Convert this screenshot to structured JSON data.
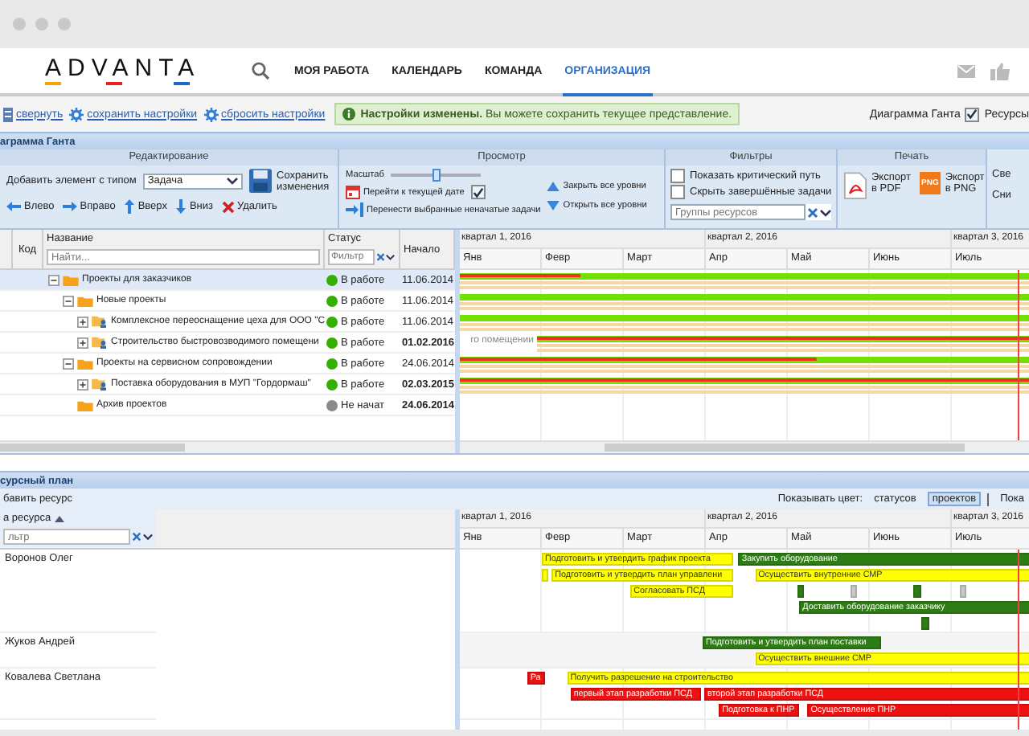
{
  "header": {
    "logo": "ADVANTA",
    "nav": [
      {
        "label": "МОЯ РАБОТА",
        "selected": false
      },
      {
        "label": "КАЛЕНДАРЬ",
        "selected": false
      },
      {
        "label": "КОМАНДА",
        "selected": false
      },
      {
        "label": "ОРГАНИЗАЦИЯ",
        "selected": true
      }
    ]
  },
  "toolbar": {
    "links": [
      {
        "label": "свернуть",
        "kind": "collapse"
      },
      {
        "label": "сохранить настройки",
        "kind": "settings"
      },
      {
        "label": "сбросить настройки",
        "kind": "settings"
      }
    ],
    "notice": "**Настройки изменены.** Вы можете сохранить текущее представление.",
    "view_toggles": [
      {
        "label": "Диаграмма Ганта",
        "checked": true
      },
      {
        "label": "Ресурсы"
      }
    ]
  },
  "gantt_panel": {
    "title": "аграмма Ганта",
    "ribbon": {
      "editing": {
        "title": "Редактирование",
        "add_label": "Добавить элемент с типом",
        "type_select": "Задача",
        "save_button": "Сохранить изменения",
        "move_buttons": [
          {
            "label": "Влево",
            "kind": "left"
          },
          {
            "label": "Вправо",
            "kind": "right"
          },
          {
            "label": "Вверх",
            "kind": "up"
          },
          {
            "label": "Вниз",
            "kind": "down"
          },
          {
            "label": "Удалить",
            "kind": "delete"
          }
        ]
      },
      "view": {
        "title": "Просмотр",
        "scale_label": "Масштаб",
        "scale": {
          "level": 0.5
        },
        "today_button": "Перейти к текущей дате",
        "today_checked": true,
        "transfer_button": "Перенести выбранные неначатые задачи",
        "level_buttons": [
          {
            "label": "Закрыть все уровни",
            "kind": "collapse"
          },
          {
            "label": "Открыть все уровни",
            "kind": "expand"
          }
        ]
      },
      "filters": {
        "title": "Фильтры",
        "checks": [
          {
            "label": "Показать критический путь",
            "checked": false
          },
          {
            "label": "Скрыть завершённые задачи",
            "checked": false
          }
        ],
        "resource_groups": {
          "placeholder": "Группы ресурсов"
        }
      },
      "print": {
        "title": "Печать",
        "buttons": [
          {
            "label": "Экспорт в PDF",
            "kind": "pdf"
          },
          {
            "label": "Экспорт в PNG",
            "kind": "png",
            "badge": "PNG"
          }
        ]
      },
      "cut_group": {
        "items": [
          "Све",
          "Сни"
        ]
      }
    },
    "grid": {
      "columns": [
        "Код",
        "Название",
        "Статус",
        "Начало"
      ],
      "name_filter": {
        "placeholder": "Найти..."
      },
      "status_filter": {
        "placeholder": "Фильтр"
      },
      "tasks": [
        {
          "name": "Проекты для заказчиков",
          "kind": "folder",
          "expanded": true,
          "selected": true,
          "status": "В работе",
          "color": "#33b000",
          "start": "11.06.2014",
          "start_bold": false,
          "children": [
            {
              "name": "Новые проекты",
              "kind": "folder",
              "expanded": true,
              "selected": false,
              "status": "В работе",
              "color": "#33b000",
              "start": "11.06.2014",
              "start_bold": false,
              "children": [
                {
                  "name": "Комплексное переоснащение цеха для ООО \"С",
                  "kind": "project",
                  "expanded": false,
                  "selected": false,
                  "status": "В работе",
                  "color": "#33b000",
                  "start": "11.06.2014",
                  "start_bold": false
                },
                {
                  "name": "Строительство быстровозводимого помещени",
                  "kind": "project",
                  "expanded": false,
                  "selected": false,
                  "status": "В работе",
                  "color": "#33b000",
                  "start": "01.02.2016",
                  "start_bold": true,
                  "chart_label": "го помещении"
                }
              ]
            },
            {
              "name": "Проекты на сервисном сопровождении",
              "kind": "folder",
              "expanded": true,
              "selected": false,
              "status": "В работе",
              "color": "#33b000",
              "start": "24.06.2014",
              "start_bold": false,
              "children": [
                {
                  "name": "Поставка оборудования в МУП \"Гордормаш\"",
                  "kind": "project",
                  "expanded": false,
                  "selected": false,
                  "status": "В работе",
                  "color": "#33b000",
                  "start": "02.03.2015",
                  "start_bold": true
                }
              ]
            },
            {
              "name": "Архив проектов",
              "kind": "folder",
              "selected": false,
              "status": "Не начат",
              "color": "#8a8a8a",
              "start": "24.06.2014",
              "start_bold": true
            }
          ]
        }
      ]
    },
    "chart": {
      "quarters": [
        "квартал 1, 2016",
        "квартал 2, 2016",
        "квартал 3, 2016"
      ],
      "months": [
        "Янв",
        "Февр",
        "Март",
        "Апр",
        "Май",
        "Июнь",
        "Июль"
      ]
    }
  },
  "resource_panel": {
    "title": "сурсный план",
    "add_button": "бавить ресурс",
    "color_label": "Показывать цвет:",
    "color_options": [
      {
        "label": "статусов",
        "selected": false
      },
      {
        "label": "проектов",
        "selected": true
      }
    ],
    "cut_option": "Пока",
    "name_column": "а ресурса",
    "filter": {
      "placeholder": "льтр"
    },
    "chart": {
      "quarters": [
        "квартал 1, 2016",
        "квартал 2, 2016",
        "квартал 3, 2016"
      ],
      "months": [
        "Янв",
        "Февр",
        "Март",
        "Апр",
        "Май",
        "Июнь",
        "Июль"
      ]
    },
    "resources": [
      {
        "name": "Воронов Олег",
        "lanes": [
          {
            "bars": [
              {
                "label": "Подготовить и утвердить график проекта",
                "color": "#ffff00"
              },
              {
                "label": "Закупить оборудование",
                "color": "#2e7d14"
              }
            ]
          },
          {
            "bars": [
              {
                "color": "#ffff00"
              },
              {
                "label": "Подготовить и утвердить план управлени",
                "color": "#ffff00"
              },
              {
                "label": "Осуществить внутренние СМР",
                "color": "#ffff00"
              }
            ]
          },
          {
            "bars": [
              {
                "label": "Согласовать ПСД",
                "color": "#ffff00"
              },
              {
                "color": "#2e7d14"
              },
              {
                "color": "#c8c8c8"
              },
              {
                "color": "#2e7d14"
              },
              {
                "color": "#c8c8c8"
              }
            ]
          },
          {
            "bars": [
              {
                "label": "Доставить оборудование заказчику",
                "color": "#2e7d14"
              }
            ]
          },
          {
            "bars": [
              {
                "color": "#2e7d14"
              }
            ]
          }
        ]
      },
      {
        "name": "Жуков Андрей",
        "lanes": [
          {
            "bars": [
              {
                "label": "Подготовить и утвердить план поставки",
                "color": "#2e7d14"
              }
            ]
          },
          {
            "bars": [
              {
                "label": "Осуществить внешние СМР",
                "color": "#ffff00"
              }
            ]
          }
        ]
      },
      {
        "name": "Ковалева Светлана",
        "lanes": [
          {
            "bars": [
              {
                "label": "Ра",
                "color": "#ee1111"
              },
              {
                "label": "Получить разрешение на строительство",
                "color": "#ffff00"
              }
            ]
          },
          {
            "bars": [
              {
                "label": "первый этап разработки ПСД",
                "color": "#ee1111"
              },
              {
                "label": "второй этап разработки ПСД",
                "color": "#ee1111"
              }
            ]
          },
          {
            "bars": [
              {
                "label": "Подготовка к ПНР",
                "color": "#ee1111"
              },
              {
                "label": "Осуществление ПНР",
                "color": "#ee1111"
              }
            ]
          }
        ]
      }
    ]
  }
}
